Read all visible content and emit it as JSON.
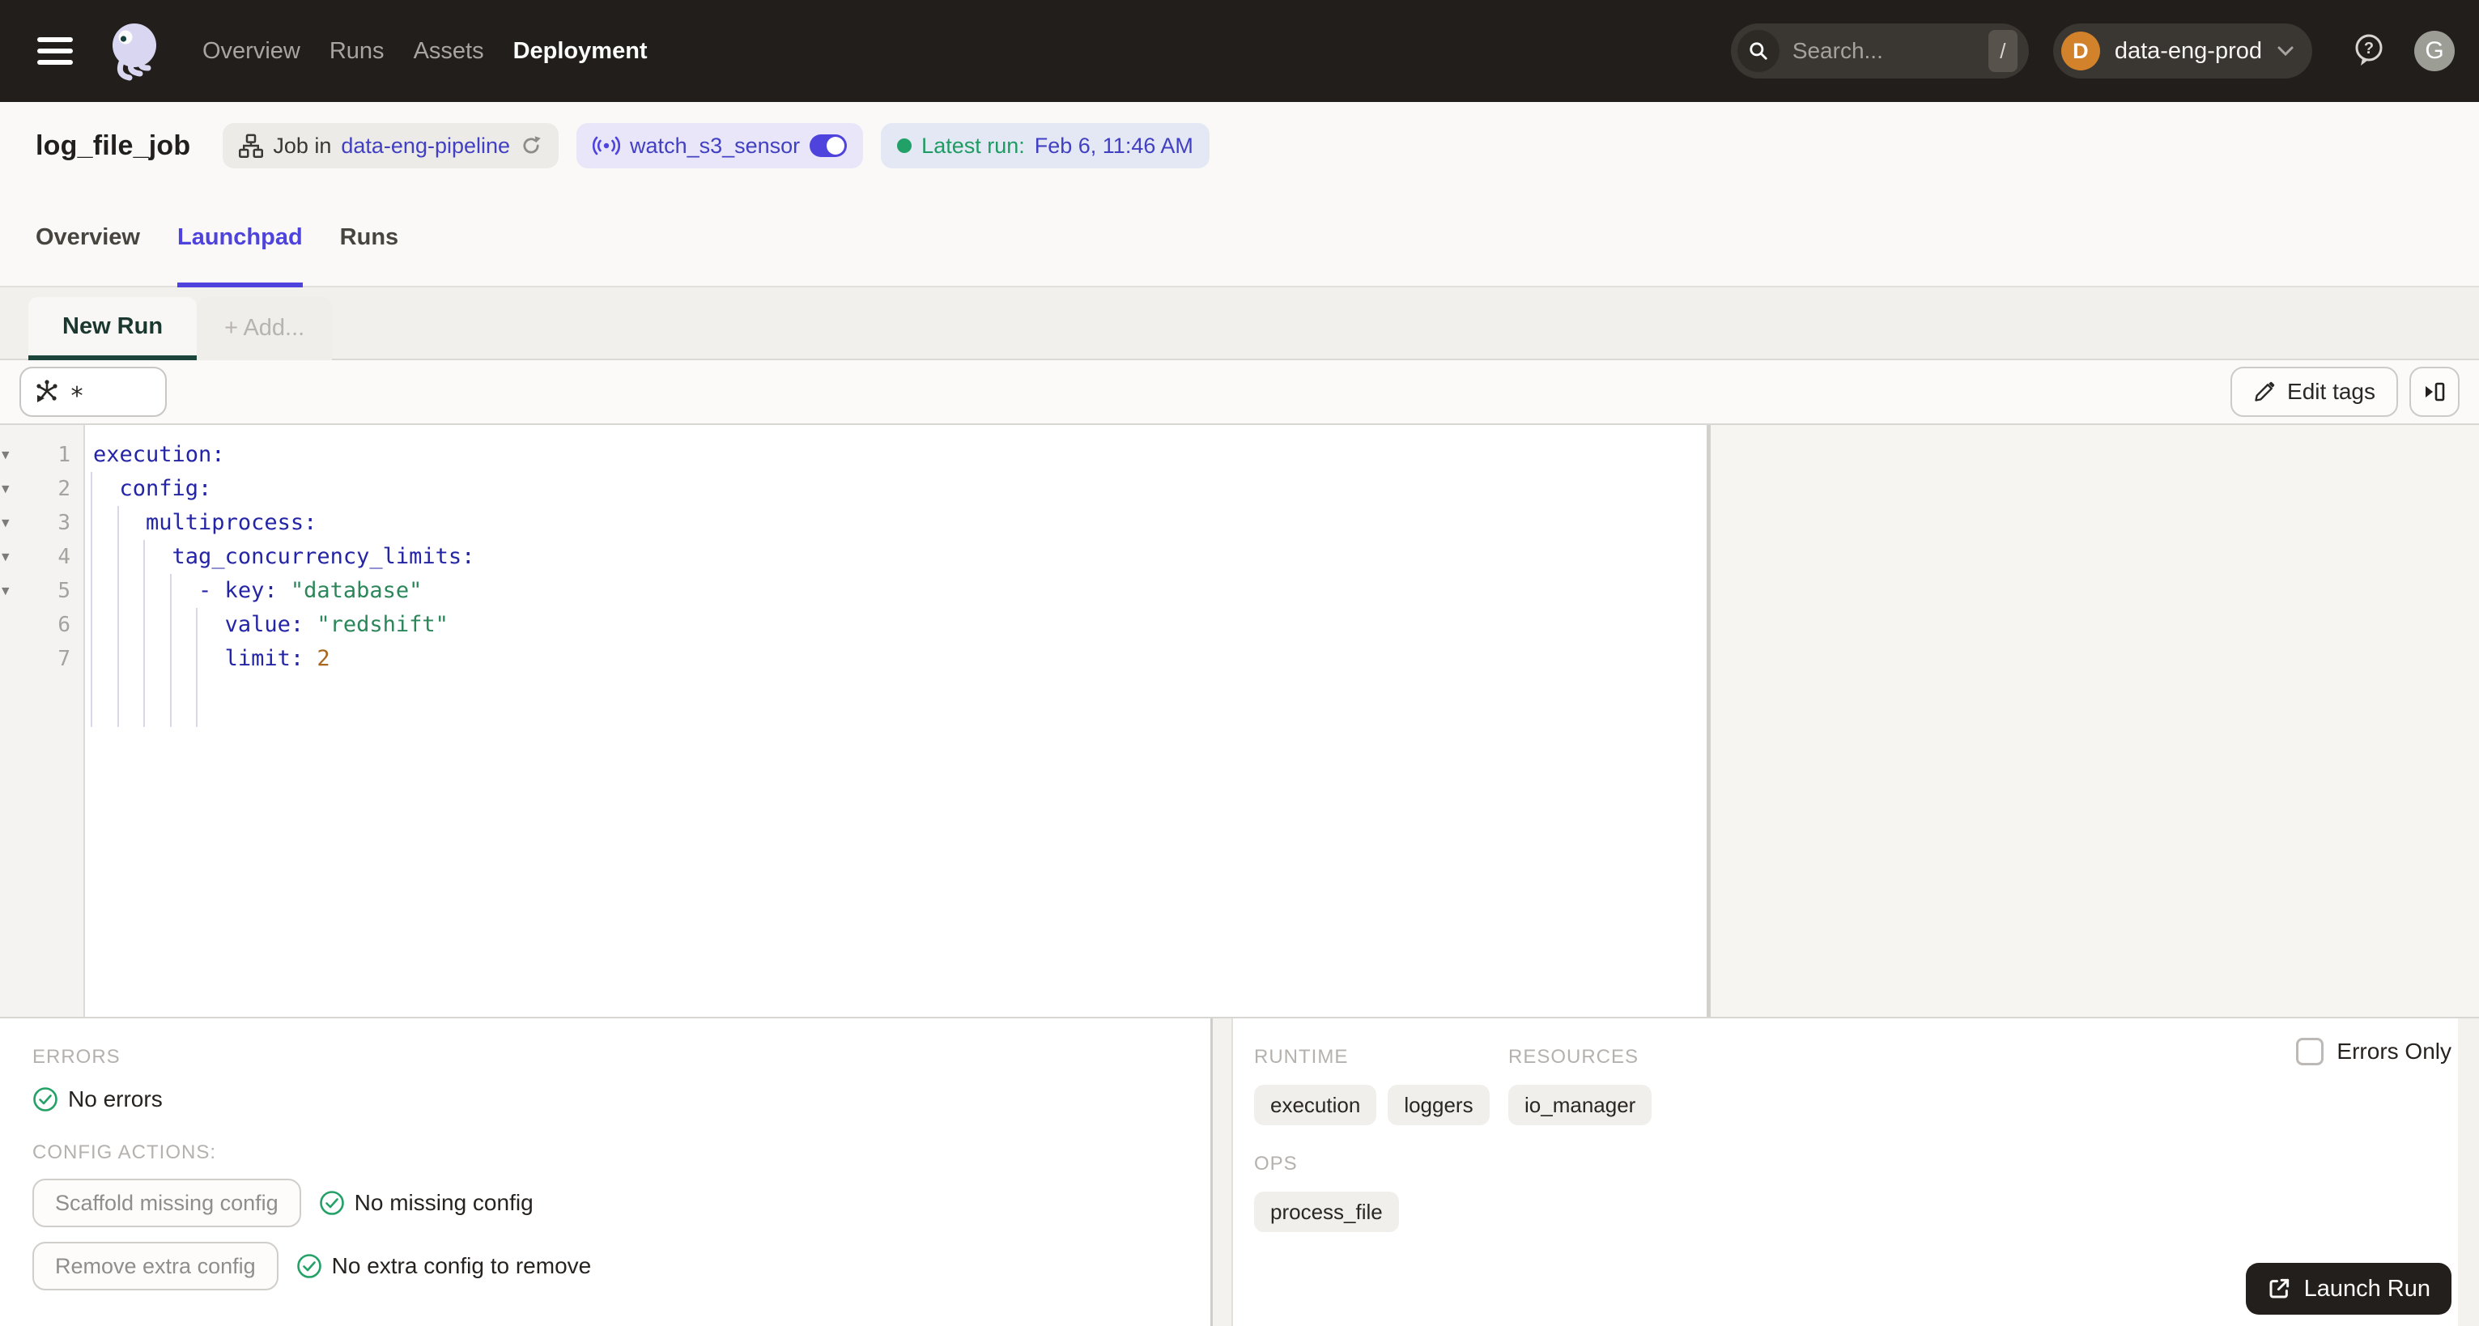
{
  "colors": {
    "topbar-bg": "#221E1B",
    "page-bg": "#FAF9F7",
    "accent": "#4F43DD",
    "link": "#4240C2",
    "green": "#21A168",
    "green-text": "#1E9B63",
    "newrun": "#1C453C",
    "code-key": "#2424A6",
    "code-string": "#2B8659",
    "code-number": "#A8661F",
    "launch-bg": "#231F1D",
    "orange": "#D2822B"
  },
  "topbar": {
    "nav": [
      {
        "label": "Overview",
        "active": false
      },
      {
        "label": "Runs",
        "active": false
      },
      {
        "label": "Assets",
        "active": false
      },
      {
        "label": "Deployment",
        "active": true
      }
    ],
    "search_placeholder": "Search...",
    "search_shortcut": "/",
    "deployment": {
      "initial": "D",
      "name": "data-eng-prod"
    },
    "user_initial": "G"
  },
  "title": {
    "job_name": "log_file_job",
    "job_pill": {
      "prefix": "Job in",
      "repo": "data-eng-pipeline"
    },
    "sensor_pill": {
      "name": "watch_s3_sensor"
    },
    "latest_run": {
      "label": "Latest run:",
      "value": "Feb 6, 11:46 AM"
    }
  },
  "tabs": [
    {
      "label": "Overview",
      "active": false
    },
    {
      "label": "Launchpad",
      "active": true
    },
    {
      "label": "Runs",
      "active": false
    }
  ],
  "launchpad": {
    "run_tab": "New Run",
    "add_tab": "+ Add...",
    "op_selector": "*",
    "edit_tags": "Edit tags"
  },
  "editor": {
    "lines": [
      {
        "fold": true,
        "seg": [
          [
            "k",
            "execution:"
          ]
        ]
      },
      {
        "fold": true,
        "seg": [
          [
            "p",
            "  "
          ],
          [
            "k",
            "config:"
          ]
        ]
      },
      {
        "fold": true,
        "seg": [
          [
            "p",
            "    "
          ],
          [
            "k",
            "multiprocess:"
          ]
        ]
      },
      {
        "fold": true,
        "seg": [
          [
            "p",
            "      "
          ],
          [
            "k",
            "tag_concurrency_limits:"
          ]
        ]
      },
      {
        "fold": true,
        "seg": [
          [
            "p",
            "        "
          ],
          [
            "k",
            "- key:"
          ],
          [
            "p",
            " "
          ],
          [
            "s",
            "\"database\""
          ]
        ]
      },
      {
        "fold": false,
        "seg": [
          [
            "p",
            "          "
          ],
          [
            "k",
            "value:"
          ],
          [
            "p",
            " "
          ],
          [
            "s",
            "\"redshift\""
          ]
        ]
      },
      {
        "fold": false,
        "seg": [
          [
            "p",
            "          "
          ],
          [
            "k",
            "limit:"
          ],
          [
            "p",
            " "
          ],
          [
            "n",
            "2"
          ]
        ]
      }
    ],
    "guides": [
      {
        "col": 0,
        "from": 2
      },
      {
        "col": 2,
        "from": 3
      },
      {
        "col": 4,
        "from": 4
      },
      {
        "col": 6,
        "from": 5
      },
      {
        "col": 8,
        "from": 6
      }
    ]
  },
  "panels": {
    "errors": {
      "heading": "ERRORS",
      "status": "No errors"
    },
    "config_actions": {
      "heading": "CONFIG ACTIONS:",
      "actions": [
        {
          "button": "Scaffold missing config",
          "status": "No missing config"
        },
        {
          "button": "Remove extra config",
          "status": "No extra config to remove"
        }
      ]
    }
  },
  "right_panel": {
    "runtime": {
      "heading": "RUNTIME",
      "tags": [
        "execution",
        "loggers"
      ]
    },
    "resources": {
      "heading": "RESOURCES",
      "tags": [
        "io_manager"
      ]
    },
    "ops": {
      "heading": "OPS",
      "tags": [
        "process_file"
      ]
    },
    "errors_only": "Errors Only",
    "launch": "Launch Run"
  }
}
